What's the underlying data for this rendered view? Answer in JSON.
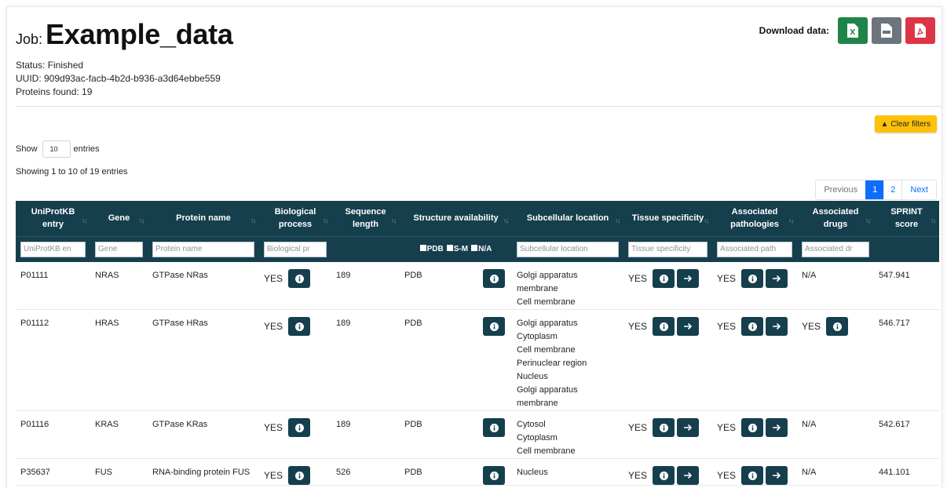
{
  "job": {
    "prefix": "Job:",
    "title": "Example_data"
  },
  "meta": {
    "status": "Status: Finished",
    "uuid": "UUID: 909d93ac-facb-4b2d-b936-a3d64ebbe559",
    "proteins": "Proteins found: 19"
  },
  "download": {
    "label": "Download data:",
    "formats": [
      "xls",
      "csv",
      "pdf"
    ]
  },
  "clear_filters": "Clear filters",
  "length": {
    "show": "Show",
    "value": "10",
    "entries": "entries"
  },
  "info": "Showing 1 to 10 of 19 entries",
  "pager": {
    "prev": "Previous",
    "pages": [
      "1",
      "2"
    ],
    "active": "1",
    "next": "Next"
  },
  "columns": [
    {
      "label": "UniProtKB entry"
    },
    {
      "label": "Gene"
    },
    {
      "label": "Protein name"
    },
    {
      "label": "Biological process"
    },
    {
      "label": "Sequence length"
    },
    {
      "label": "Structure availability"
    },
    {
      "label": "Subcellular location"
    },
    {
      "label": "Tissue specificity"
    },
    {
      "label": "Associated pathologies"
    },
    {
      "label": "Associated drugs"
    },
    {
      "label": "SPRINT score"
    }
  ],
  "filters": {
    "uniprot": "UniProtKB en",
    "gene": "Gene",
    "protein": "Protein name",
    "bio": "Biological pr",
    "subcell": "Subcellular location",
    "tissue": "Tissue specificity",
    "patho": "Associated path",
    "drugs": "Associated dr",
    "struct": [
      "PDB",
      "S-M",
      "N/A"
    ]
  },
  "rows": [
    {
      "entry": "P01111",
      "gene": "NRAS",
      "protein": "GTPase NRas",
      "bio": "YES",
      "length": "189",
      "struct": "PDB",
      "subcell": [
        "Golgi apparatus membrane",
        "Cell membrane"
      ],
      "tissue": "YES",
      "patho": "YES",
      "drugs": "N/A",
      "score": "547.941"
    },
    {
      "entry": "P01112",
      "gene": "HRAS",
      "protein": "GTPase HRas",
      "bio": "YES",
      "length": "189",
      "struct": "PDB",
      "subcell": [
        "Golgi apparatus",
        "Cytoplasm",
        "Cell membrane",
        "Perinuclear region",
        "Nucleus",
        "Golgi apparatus membrane"
      ],
      "tissue": "YES",
      "patho": "YES",
      "drugs": "YES",
      "score": "546.717"
    },
    {
      "entry": "P01116",
      "gene": "KRAS",
      "protein": "GTPase KRas",
      "bio": "YES",
      "length": "189",
      "struct": "PDB",
      "subcell": [
        "Cytosol",
        "Cytoplasm",
        "Cell membrane"
      ],
      "tissue": "YES",
      "patho": "YES",
      "drugs": "N/A",
      "score": "542.617"
    },
    {
      "entry": "P35637",
      "gene": "FUS",
      "protein": "RNA-binding protein FUS",
      "bio": "YES",
      "length": "526",
      "struct": "PDB",
      "subcell": [
        "Nucleus"
      ],
      "tissue": "YES",
      "patho": "YES",
      "drugs": "N/A",
      "score": "441.101"
    }
  ],
  "colors": {
    "header": "#163f4d",
    "accent": "#0d6efd",
    "warning": "#ffc107",
    "excel": "#1e8449",
    "csv": "#6c757d",
    "pdf": "#dc3545"
  }
}
